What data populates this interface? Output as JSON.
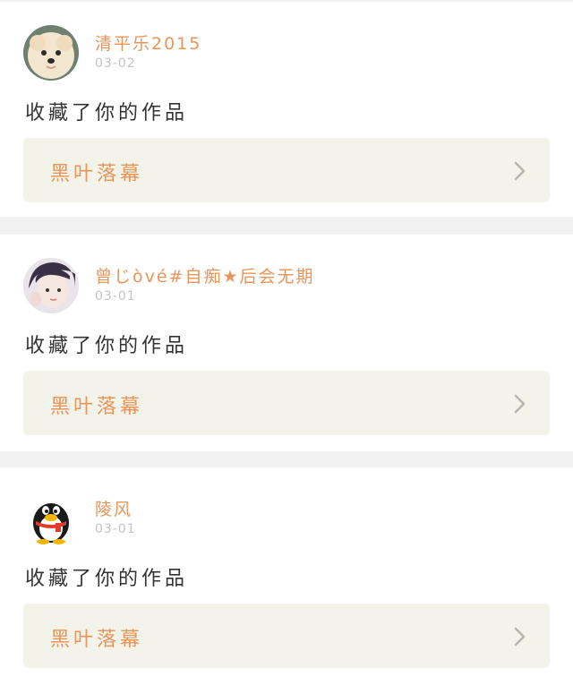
{
  "feed": {
    "items": [
      {
        "username": "清平乐2015",
        "date": "03-02",
        "action": "收藏了你的作品",
        "work_title": "黑叶落幕",
        "avatar": "pomeranian-dog-avatar"
      },
      {
        "username": "曾じòvé#自痴★后会无期",
        "date": "03-01",
        "action": "收藏了你的作品",
        "work_title": "黑叶落幕",
        "avatar": "girl-portrait-avatar"
      },
      {
        "username": "陵风",
        "date": "03-01",
        "action": "收藏了你的作品",
        "work_title": "黑叶落幕",
        "avatar": "qq-penguin-avatar"
      }
    ]
  },
  "colors": {
    "username": "#e8955a",
    "date": "#c4c4c4",
    "action_text": "#333333",
    "work_card_bg": "#f3f3ea",
    "separator": "#f2f2f2",
    "chevron": "#b5b5b5"
  }
}
